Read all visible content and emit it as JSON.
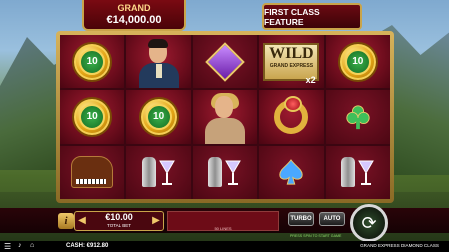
{
  "jackpot": {
    "label": "GRAND",
    "value": "€14,000.00"
  },
  "feature_banner": "FIRST CLASS FEATURE",
  "reels": {
    "symbols": [
      [
        "coin-10",
        "man-portrait",
        "diamond",
        "wild",
        "coin-10"
      ],
      [
        "coin-10",
        "coin-10",
        "woman-portrait",
        "ring",
        "club"
      ],
      [
        "piano",
        "drinks",
        "drinks",
        "spade",
        "drinks"
      ]
    ],
    "coin_value": "10",
    "wild": {
      "word": "WILD",
      "sub": "GRAND EXPRESS",
      "multiplier": "x2"
    }
  },
  "controls": {
    "info_label": "i",
    "bet_value": "€10.00",
    "bet_label": "TOTAL BET",
    "paylines_label": "50 LINES",
    "turbo_label": "TURBO",
    "auto_label": "AUTO",
    "spin_hint": "PRESS SPIN TO START GAME"
  },
  "footer": {
    "cash": "CASH: €912.80",
    "game_title": "GRAND EXPRESS DIAMOND CLASS"
  },
  "colors": {
    "accent_gold": "#c9a44a",
    "reel_bg": "#6e0d1d",
    "hint_green": "#8fe06d"
  }
}
